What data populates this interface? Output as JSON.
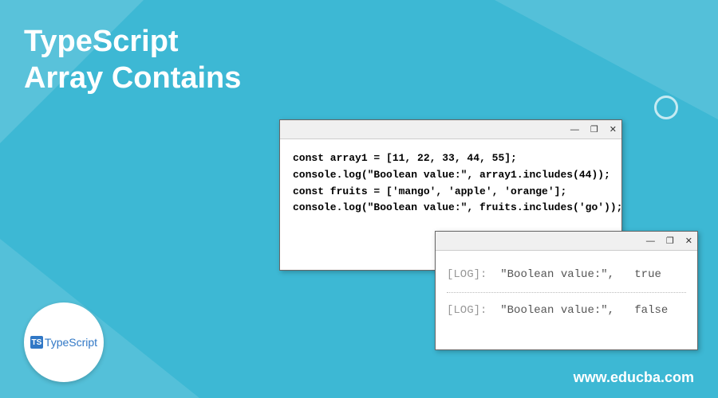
{
  "title_line1": "TypeScript",
  "title_line2": "Array Contains",
  "code": {
    "line1": "const array1 = [11, 22, 33, 44, 55];",
    "line2": "console.log(\"Boolean value:\", array1.includes(44));",
    "line3": "const fruits = ['mango', 'apple', 'orange'];",
    "line4": "console.log(\"Boolean value:\", fruits.includes('go'));"
  },
  "output": {
    "log_prefix": "[LOG]:",
    "msg": "\"Boolean value:\",",
    "val1": "true",
    "val2": "false"
  },
  "window_controls": {
    "minimize": "—",
    "maximize": "❐",
    "close": "✕"
  },
  "logo": {
    "square": "TS",
    "text": "TypeScript"
  },
  "website": "www.educba.com"
}
